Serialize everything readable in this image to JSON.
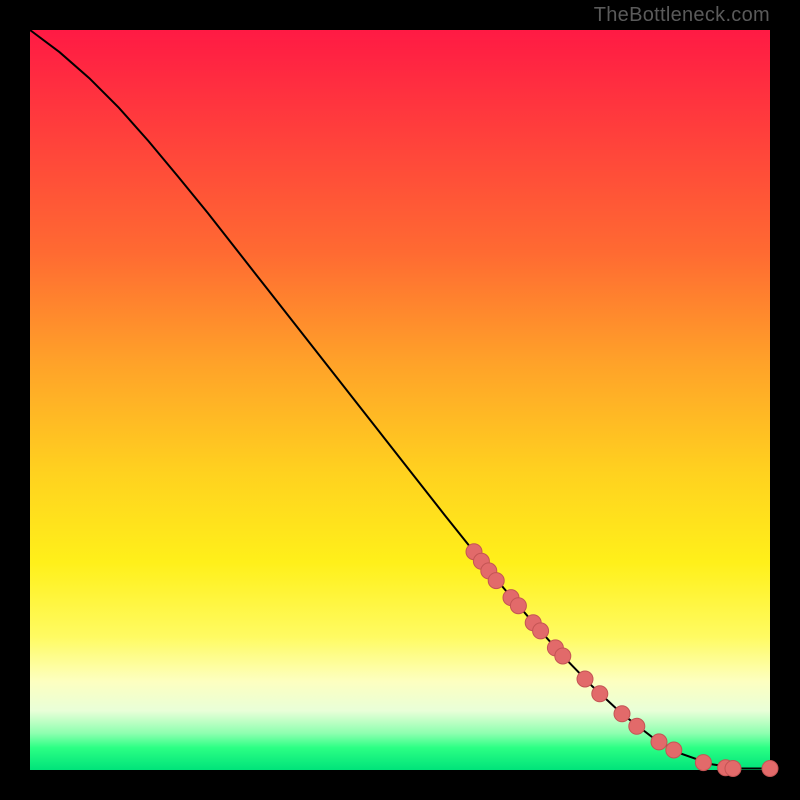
{
  "watermark": "TheBottleneck.com",
  "colors": {
    "curve": "#000000",
    "marker_fill": "#e26a6a",
    "marker_stroke": "#c45454"
  },
  "chart_data": {
    "type": "line",
    "title": "",
    "xlabel": "",
    "ylabel": "",
    "xlim": [
      0,
      100
    ],
    "ylim": [
      0,
      100
    ],
    "grid": false,
    "legend": false,
    "series": [
      {
        "name": "curve",
        "x": [
          0,
          4,
          8,
          12,
          16,
          20,
          24,
          28,
          32,
          36,
          40,
          44,
          48,
          52,
          56,
          60,
          64,
          68,
          72,
          76,
          80,
          84,
          88,
          92,
          96,
          100
        ],
        "y": [
          100,
          97,
          93.5,
          89.5,
          85,
          80.2,
          75.3,
          70.2,
          65.1,
          60,
          54.9,
          49.8,
          44.7,
          39.6,
          34.5,
          29.5,
          24.6,
          19.9,
          15.4,
          11.3,
          7.6,
          4.5,
          2.2,
          0.8,
          0.2,
          0.2
        ]
      }
    ],
    "markers": [
      {
        "x": 60,
        "y": 29.5
      },
      {
        "x": 61,
        "y": 28.2
      },
      {
        "x": 62,
        "y": 26.9
      },
      {
        "x": 63,
        "y": 25.6
      },
      {
        "x": 65,
        "y": 23.3
      },
      {
        "x": 66,
        "y": 22.2
      },
      {
        "x": 68,
        "y": 19.9
      },
      {
        "x": 69,
        "y": 18.8
      },
      {
        "x": 71,
        "y": 16.5
      },
      {
        "x": 72,
        "y": 15.4
      },
      {
        "x": 75,
        "y": 12.3
      },
      {
        "x": 77,
        "y": 10.3
      },
      {
        "x": 80,
        "y": 7.6
      },
      {
        "x": 82,
        "y": 5.9
      },
      {
        "x": 85,
        "y": 3.8
      },
      {
        "x": 87,
        "y": 2.7
      },
      {
        "x": 91,
        "y": 1.0
      },
      {
        "x": 94,
        "y": 0.3
      },
      {
        "x": 95,
        "y": 0.2
      },
      {
        "x": 100,
        "y": 0.2
      }
    ]
  }
}
